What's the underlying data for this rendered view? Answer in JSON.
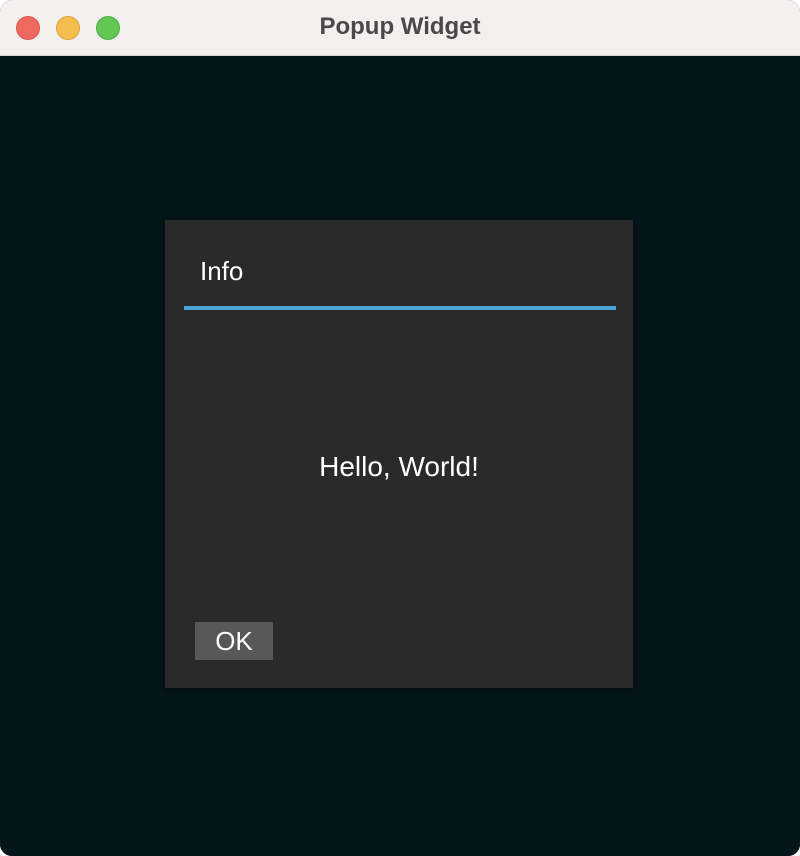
{
  "window": {
    "title": "Popup Widget"
  },
  "popup": {
    "title": "Info",
    "message": "Hello, World!",
    "ok_label": "OK"
  },
  "colors": {
    "background": "#04161a",
    "popup_background": "#2a2a2a",
    "accent": "#4aa3d3",
    "button_background": "#585858",
    "text": "#ffffff"
  }
}
